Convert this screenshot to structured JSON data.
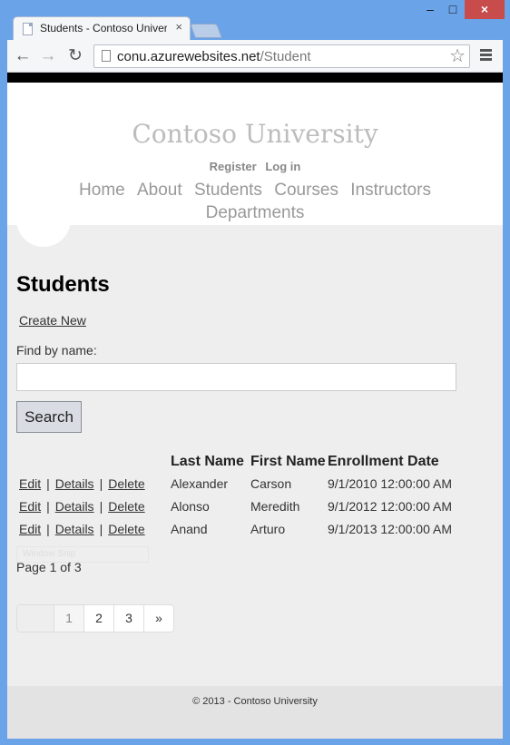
{
  "browser": {
    "tab_title": "Students - Contoso Univer",
    "tab_close": "×",
    "url_host": "conu.azurewebsites.net",
    "url_path": "/Student",
    "window_controls": {
      "minimize": "–",
      "maximize": "□",
      "close": "×"
    },
    "icons": {
      "back": "arrow-left",
      "forward": "arrow-right",
      "reload": "reload",
      "star": "star-outline",
      "menu": "hamburger"
    }
  },
  "site": {
    "title": "Contoso University",
    "register": "Register",
    "login": "Log in",
    "menu": [
      "Home",
      "About",
      "Students",
      "Courses",
      "Instructors",
      "Departments"
    ]
  },
  "page": {
    "heading": "Students",
    "create_new": "Create New",
    "find_label": "Find by name:",
    "search_value": "",
    "search_button": "Search"
  },
  "table": {
    "headers": [
      "Last Name",
      "First Name",
      "Enrollment Date"
    ],
    "action_labels": {
      "edit": "Edit",
      "details": "Details",
      "delete": "Delete",
      "separator": "|"
    },
    "rows": [
      {
        "last": "Alexander",
        "first": "Carson",
        "date": "9/1/2010 12:00:00 AM"
      },
      {
        "last": "Alonso",
        "first": "Meredith",
        "date": "9/1/2012 12:00:00 AM"
      },
      {
        "last": "Anand",
        "first": "Arturo",
        "date": "9/1/2013 12:00:00 AM"
      }
    ]
  },
  "overlay_text": "Window Snip",
  "pagination": {
    "info": "Page 1 of 3",
    "pages": [
      "1",
      "2",
      "3"
    ],
    "next": "»"
  },
  "footer": {
    "text": "© 2013 - Contoso University"
  },
  "colors": {
    "chrome_frame": "#6aa3e8",
    "close_button": "#c94c4c",
    "site_title": "#bcbcbc",
    "content_bg": "#eeeeee"
  }
}
